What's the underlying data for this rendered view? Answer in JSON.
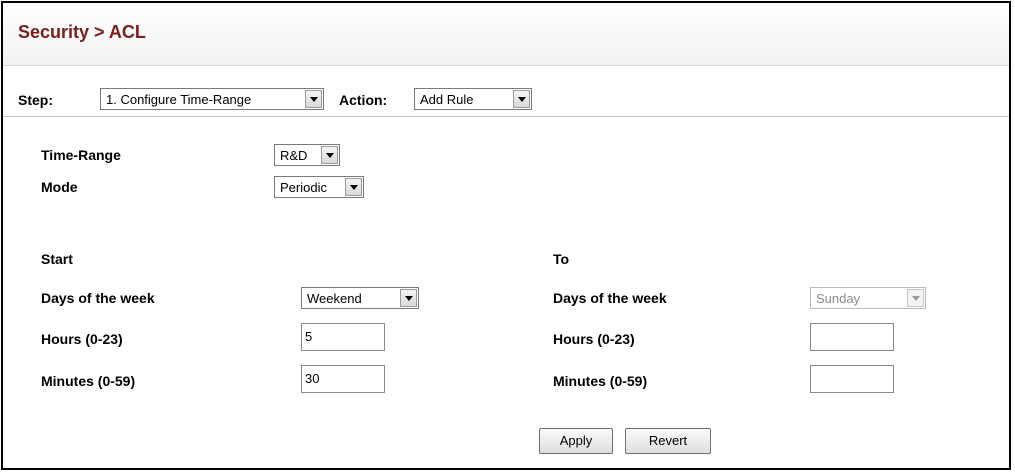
{
  "title": "Security > ACL",
  "step": {
    "label": "Step:",
    "value": "1. Configure Time-Range"
  },
  "action": {
    "label": "Action:",
    "value": "Add Rule"
  },
  "time_range": {
    "label": "Time-Range",
    "value": "R&D"
  },
  "mode": {
    "label": "Mode",
    "value": "Periodic"
  },
  "start": {
    "heading": "Start",
    "days_label": "Days of the week",
    "days_value": "Weekend",
    "hours_label": "Hours (0-23)",
    "hours_value": "5",
    "minutes_label": "Minutes (0-59)",
    "minutes_value": "30"
  },
  "to": {
    "heading": "To",
    "days_label": "Days of the week",
    "days_value": "Sunday",
    "hours_label": "Hours (0-23)",
    "hours_value": "",
    "minutes_label": "Minutes (0-59)",
    "minutes_value": ""
  },
  "buttons": {
    "apply": "Apply",
    "revert": "Revert"
  },
  "colors": {
    "title": "#7a1d1d",
    "border": "#000000"
  }
}
